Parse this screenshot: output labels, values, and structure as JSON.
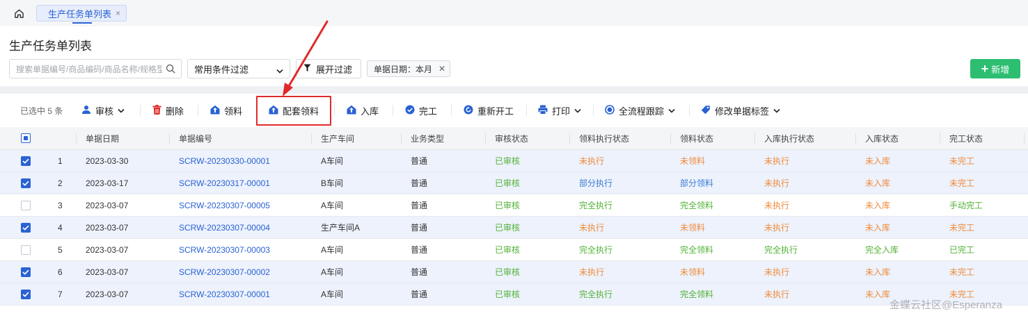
{
  "tabs": {
    "home_icon": "home-icon",
    "active_tab_label": "生产任务单列表",
    "close_glyph": "×"
  },
  "header": {
    "title": "生产任务单列表",
    "search_placeholder": "搜索单据编号/商品编码/商品名称/规格型号",
    "filter_select_value": "常用条件过滤",
    "expand_filter_label": "展开过滤",
    "date_chip_label": "单据日期：本月",
    "new_button_label": "新增"
  },
  "toolbar": {
    "selected_count": "已选中 5 条",
    "audit": "审核",
    "delete": "删除",
    "pick_material": "领料",
    "kit_pick_material": "配套领料",
    "stock_in": "入库",
    "complete": "完工",
    "restart": "重新开工",
    "print": "打印",
    "full_trace": "全流程跟踪",
    "edit_tags": "修改单据标签"
  },
  "colors": {
    "primary": "#2a62d4",
    "success_green": "#52b236",
    "warning_orange": "#f08a3a",
    "info_blue": "#3a7bd5",
    "new_button_green": "#2dbe72",
    "highlight_red": "#e02a2a"
  },
  "table": {
    "columns": [
      "单据日期",
      "单据编号",
      "生产车间",
      "业务类型",
      "审核状态",
      "领料执行状态",
      "领料状态",
      "入库执行状态",
      "入库状态",
      "完工状态"
    ],
    "rows": [
      {
        "selected": true,
        "idx": "1",
        "date": "2023-03-30",
        "no": "SCRW-20230330-00001",
        "workshop": "A车间",
        "biz": "普通",
        "audit": "已审核",
        "pick_exec": "未执行",
        "pick": "未领料",
        "in_exec": "未执行",
        "in": "未入库",
        "done": "未完工"
      },
      {
        "selected": true,
        "idx": "2",
        "date": "2023-03-17",
        "no": "SCRW-20230317-00001",
        "workshop": "B车间",
        "biz": "普通",
        "audit": "已审核",
        "pick_exec": "部分执行",
        "pick": "部分领料",
        "in_exec": "未执行",
        "in": "未入库",
        "done": "未完工"
      },
      {
        "selected": false,
        "idx": "3",
        "date": "2023-03-07",
        "no": "SCRW-20230307-00005",
        "workshop": "A车间",
        "biz": "普通",
        "audit": "已审核",
        "pick_exec": "完全执行",
        "pick": "完全领料",
        "in_exec": "未执行",
        "in": "未入库",
        "done": "手动完工"
      },
      {
        "selected": true,
        "idx": "4",
        "date": "2023-03-07",
        "no": "SCRW-20230307-00004",
        "workshop": "生产车间A",
        "biz": "普通",
        "audit": "已审核",
        "pick_exec": "未执行",
        "pick": "未领料",
        "in_exec": "未执行",
        "in": "未入库",
        "done": "未完工"
      },
      {
        "selected": false,
        "idx": "5",
        "date": "2023-03-07",
        "no": "SCRW-20230307-00003",
        "workshop": "A车间",
        "biz": "普通",
        "audit": "已审核",
        "pick_exec": "完全执行",
        "pick": "完全领料",
        "in_exec": "完全执行",
        "in": "完全入库",
        "done": "已完工"
      },
      {
        "selected": true,
        "idx": "6",
        "date": "2023-03-07",
        "no": "SCRW-20230307-00002",
        "workshop": "A车间",
        "biz": "普通",
        "audit": "已审核",
        "pick_exec": "未执行",
        "pick": "未领料",
        "in_exec": "未执行",
        "in": "未入库",
        "done": "未完工"
      },
      {
        "selected": true,
        "idx": "7",
        "date": "2023-03-07",
        "no": "SCRW-20230307-00001",
        "workshop": "A车间",
        "biz": "普通",
        "audit": "已审核",
        "pick_exec": "完全执行",
        "pick": "完全领料",
        "in_exec": "未执行",
        "in": "未入库",
        "done": "未完工"
      }
    ]
  },
  "watermark": "金蝶云社区@Esperanza"
}
